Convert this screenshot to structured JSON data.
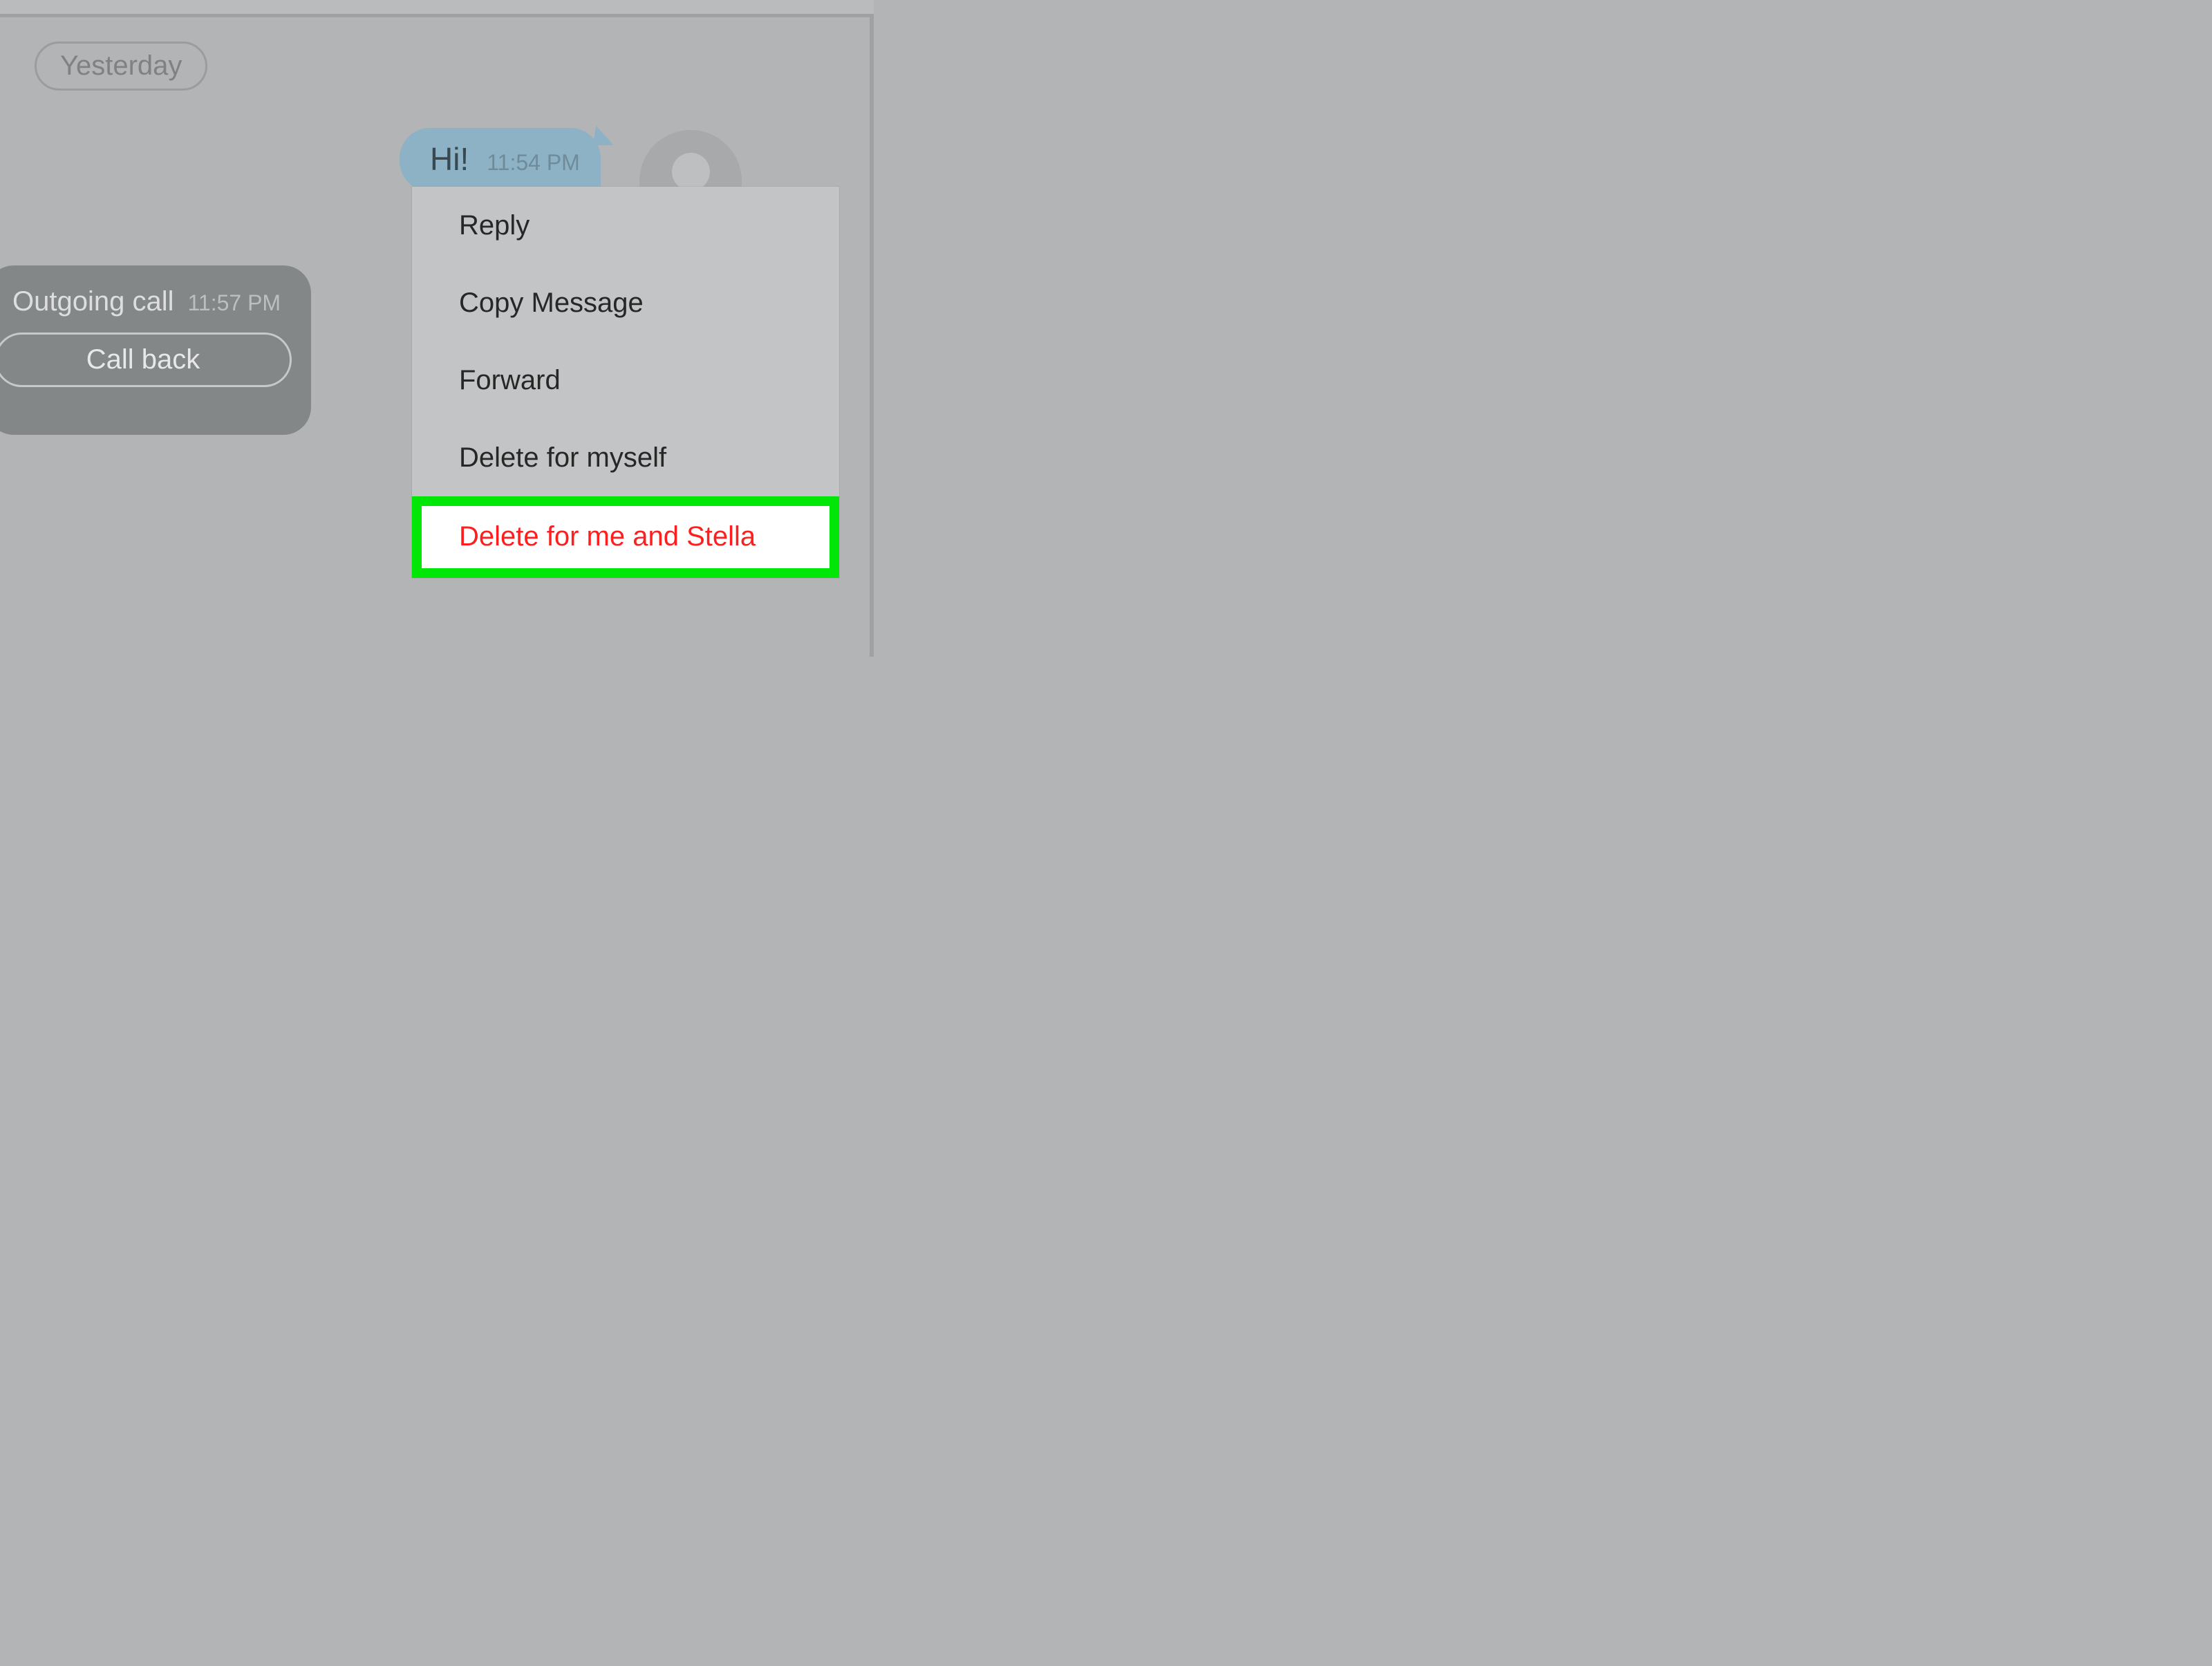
{
  "date_separator": "Yesterday",
  "call": {
    "title": "Outgoing call",
    "time": "11:57 PM",
    "call_back_label": "Call back"
  },
  "message": {
    "text": "Hi!",
    "time": "11:54 PM"
  },
  "context_menu": {
    "reply": "Reply",
    "copy": "Copy Message",
    "forward": "Forward",
    "delete_self": "Delete for myself",
    "delete_both": "Delete for me and Stella"
  }
}
